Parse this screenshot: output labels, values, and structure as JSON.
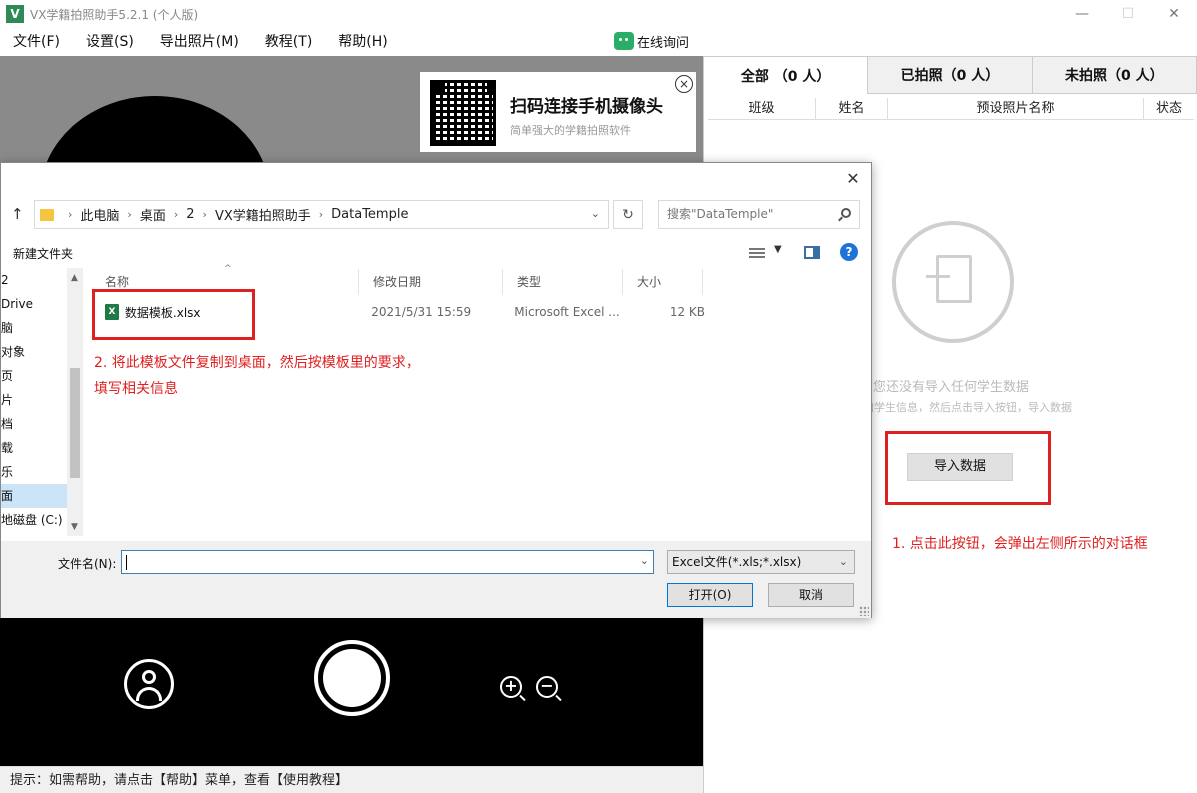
{
  "app": {
    "logo": "V",
    "title": "VX学籍拍照助手5.2.1 (个人版)",
    "window_controls": [
      "—",
      "☐",
      "✕"
    ]
  },
  "menu": [
    "文件(F)",
    "设置(S)",
    "导出照片(M)",
    "教程(T)",
    "帮助(H)"
  ],
  "consult": {
    "icon": "wechat-icon",
    "label": "在线询问"
  },
  "banner": {
    "title": "扫码连接手机摄像头",
    "subtitle": "简单强大的学籍拍照软件",
    "close": "×"
  },
  "camera_controls": {
    "zoom_in": "+",
    "zoom_out": "−"
  },
  "status_bar": "提示：如需帮助，请点击【帮助】菜单，查看【使用教程】",
  "right_panel": {
    "tabs": [
      "全部 （0 人）",
      "已拍照（0 人）",
      "未拍照（0 人）"
    ],
    "columns": [
      "班级",
      "姓名",
      "预设照片名称",
      "状态"
    ],
    "empty_title": "您还没有导入任何学生数据",
    "empty_hint": "板，添加学生信息，然后点击导入按钮，导入数据",
    "import_button": "导入数据",
    "note": "1. 点击此按钮，会弹出左侧所示的对话框"
  },
  "dialog": {
    "close": "✕",
    "up": "↑",
    "breadcrumb": [
      "此电脑",
      "桌面",
      "2",
      "VX学籍拍照助手",
      "DataTemple"
    ],
    "search_placeholder": "搜索\"DataTemple\"",
    "refresh": "↻",
    "new_folder": "新建文件夹",
    "help": "?",
    "nav_items": [
      "2",
      "Drive",
      "脑",
      "对象",
      "页",
      "片",
      "档",
      "载",
      "乐",
      "面",
      "地磁盘 (C:)"
    ],
    "nav_selected_index": 9,
    "file_columns": [
      "名称",
      "修改日期",
      "类型",
      "大小"
    ],
    "files": [
      {
        "name": "数据模板.xlsx",
        "modified": "2021/5/31 15:59",
        "type": "Microsoft Excel ...",
        "size": "12 KB",
        "icon": "excel-icon"
      }
    ],
    "note": "2. 将此模板文件复制到桌面，然后按模板里的要求，填写相关信息",
    "filename_label": "文件名(N):",
    "filename_value": "",
    "filter": "Excel文件(*.xls;*.xlsx)",
    "open_button": "打开(O)",
    "cancel_button": "取消"
  },
  "colors": {
    "highlight": "#e02020",
    "accent": "#0078d7",
    "excel": "#1f7a45"
  }
}
